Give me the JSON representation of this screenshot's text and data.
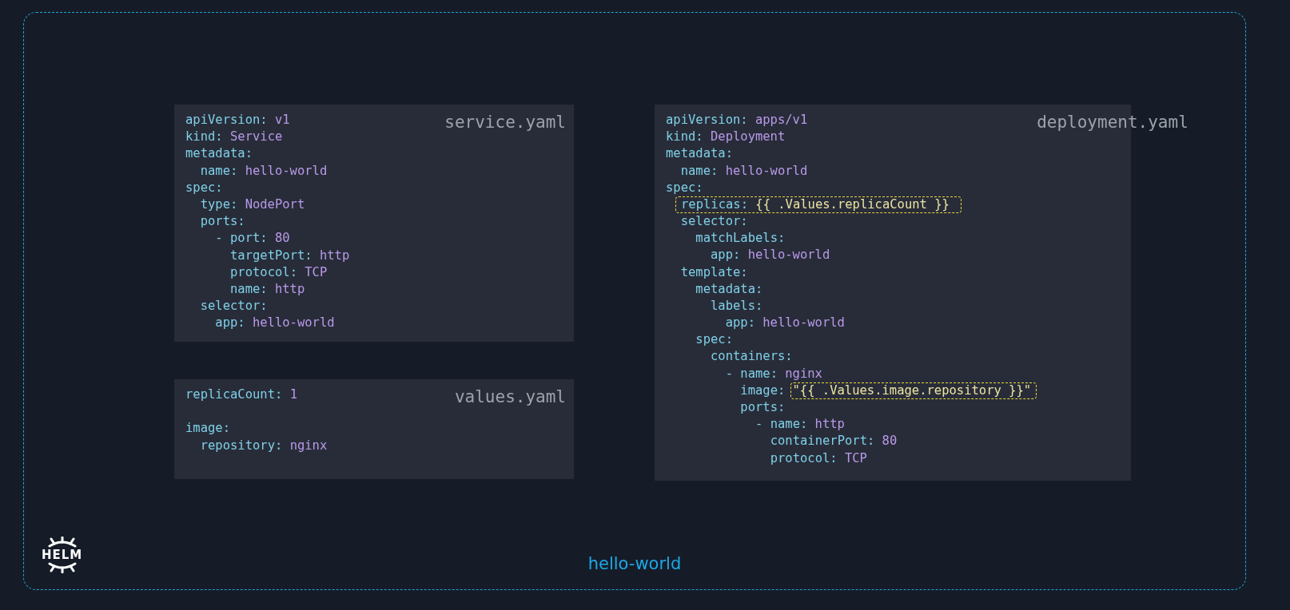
{
  "files": [
    {
      "title": "service.yaml",
      "lines": [
        {
          "kind": "pair",
          "key": "apiVersion:",
          "value": "v1"
        },
        {
          "kind": "pair",
          "key": "kind:",
          "value": "Service"
        },
        {
          "kind": "pair",
          "key": "metadata:"
        },
        {
          "kind": "pair",
          "key": "  name:",
          "value": "hello-world"
        },
        {
          "kind": "pair",
          "key": "spec:"
        },
        {
          "kind": "pair",
          "key": "  type:",
          "value": "NodePort"
        },
        {
          "kind": "pair",
          "key": "  ports:"
        },
        {
          "kind": "pair",
          "key": "    - port:",
          "value": "80"
        },
        {
          "kind": "pair",
          "key": "      targetPort:",
          "value": "http"
        },
        {
          "kind": "pair",
          "key": "      protocol:",
          "value": "TCP"
        },
        {
          "kind": "pair",
          "key": "      name:",
          "value": "http"
        },
        {
          "kind": "pair",
          "key": "  selector:"
        },
        {
          "kind": "pair",
          "key": "    app:",
          "value": "hello-world"
        }
      ]
    },
    {
      "title": "values.yaml",
      "lines": [
        {
          "kind": "pair",
          "key": "replicaCount:",
          "value": "1"
        },
        {
          "kind": "blank"
        },
        {
          "kind": "pair",
          "key": "image:"
        },
        {
          "kind": "pair",
          "key": "  repository:",
          "value": "nginx"
        }
      ]
    },
    {
      "title": "deployment.yaml",
      "lines": [
        {
          "kind": "pair",
          "key": "apiVersion:",
          "value": "apps/v1"
        },
        {
          "kind": "pair",
          "key": "kind:",
          "value": "Deployment"
        },
        {
          "kind": "pair",
          "key": "metadata:"
        },
        {
          "kind": "pair",
          "key": "  name:",
          "value": "hello-world"
        },
        {
          "kind": "pair",
          "key": "spec:"
        },
        {
          "kind": "highlighted-line",
          "key": "replicas:",
          "value": "{{ .Values.replicaCount }}"
        },
        {
          "kind": "pair",
          "key": "  selector:"
        },
        {
          "kind": "pair",
          "key": "    matchLabels:"
        },
        {
          "kind": "pair",
          "key": "      app:",
          "value": "hello-world"
        },
        {
          "kind": "pair",
          "key": "  template:"
        },
        {
          "kind": "pair",
          "key": "    metadata:"
        },
        {
          "kind": "pair",
          "key": "      labels:"
        },
        {
          "kind": "pair",
          "key": "        app:",
          "value": "hello-world"
        },
        {
          "kind": "pair",
          "key": "    spec:"
        },
        {
          "kind": "pair",
          "key": "      containers:"
        },
        {
          "kind": "pair",
          "key": "        - name:",
          "value": "nginx"
        },
        {
          "kind": "highlighted-value",
          "key": "          image:",
          "value": "\"{{ .Values.image.repository }}\""
        },
        {
          "kind": "pair",
          "key": "          ports:"
        },
        {
          "kind": "pair",
          "key": "            - name:",
          "value": "http"
        },
        {
          "kind": "pair",
          "key": "              containerPort:",
          "value": "80"
        },
        {
          "kind": "pair",
          "key": "              protocol:",
          "value": "TCP"
        }
      ]
    }
  ],
  "logo": {
    "text": "HELM"
  },
  "chart_name": "hello-world"
}
